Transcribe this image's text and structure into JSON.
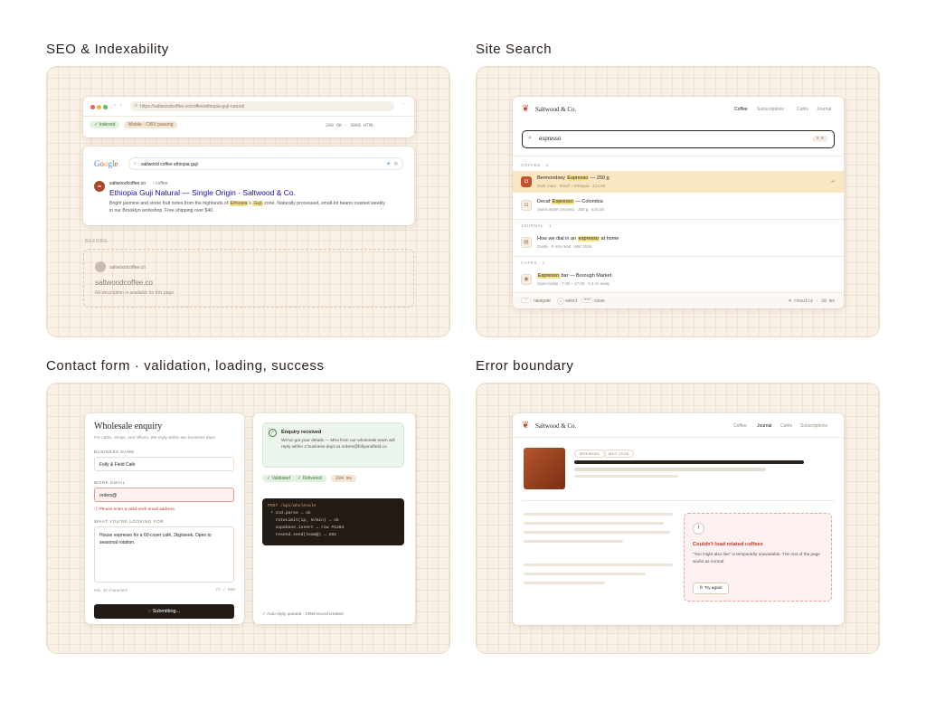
{
  "sections": {
    "seo": "SEO & Indexability",
    "search": "Site Search",
    "contact": "Contact form · validation, loading, success",
    "error": "Error boundary"
  },
  "seo": {
    "url": "https://saltwoodcoffee.co/coffee/ethiopia-guji-natural",
    "badge_indexed": "Indexed",
    "badge_mobile": "Mobile · CWV passing",
    "status": "200 OK · 38KB HTML",
    "google_logo": "Google",
    "query": "saltwood coffee ethiopia guji",
    "result_site": "saltwoodcoffee.co",
    "result_path": "› coffee",
    "result_title": "Ethiopia Guji Natural — Single Origin · Saltwood & Co.",
    "result_desc_1": "Bright jasmine and stone fruit notes from the highlands of",
    "result_desc_hl_1": "Ethiopia",
    "result_desc_2": "'s",
    "result_desc_hl_2": "Guji",
    "result_desc_3": "zone. Naturally processed, small-lot beans roasted weekly in our Brooklyn workshop. Free shipping over $40.",
    "before_label": "BEFORE",
    "before_site": "saltwoodcoffee.co",
    "before_title": "saltwoodcoffee.co",
    "before_desc": "No description is available for this page."
  },
  "search": {
    "brand": "Saltwood & Co.",
    "nav": [
      "Coffee",
      "Subscriptions",
      "Cafés",
      "Journal"
    ],
    "query": "espresso",
    "kbd": "⌘ K",
    "group_coffee": "COFFEE · 2",
    "group_journal": "JOURNAL · 1",
    "group_cafes": "CAFÉS · 1",
    "results": [
      {
        "pre": "Bermondsey ",
        "hl": "Espresso",
        "post": " — 250 g",
        "sub": "Dark roast · Brazil + Ethiopia · £14.50"
      },
      {
        "pre": "Decaf ",
        "hl": "Espresso",
        "post": " — Colombia",
        "sub": "Swiss water process · 250 g · £15.00"
      },
      {
        "pre": "How we dial in an ",
        "hl": "espresso",
        "post": " at home",
        "sub": "Guide · 6 min read · Mar 2026"
      },
      {
        "pre": "",
        "hl": "Espresso",
        "post": " bar — Borough Market",
        "sub": "Open today · 7:30 – 17:00 · 0.4 mi away"
      }
    ],
    "footer_navigate": "navigate",
    "footer_select": "select",
    "footer_close": "close",
    "footer_stats": "4 results · 38 ms"
  },
  "contact": {
    "title": "Wholesale enquiry",
    "subtitle": "For cafés, shops, and offices. We reply within two business days.",
    "label_business": "BUSINESS NAME",
    "value_business": "Folly & Field Café",
    "label_email": "WORK EMAIL",
    "value_email": "orders@",
    "error_email": "Please enter a valid work email address.",
    "label_looking": "WHAT YOU'RE LOOKING FOR",
    "value_looking": "House espresso for a 60-cover café, 2kg/week. Open to seasonal rotation.",
    "min_chars": "Min. 20 characters",
    "char_count": "72 / 500",
    "submit": "Submitting...",
    "success_title": "Enquiry received",
    "success_body": "We've got your details — Mira from our wholesale team will reply within 2 business days at orders@follyandfield.co.",
    "chip_validated": "Validated",
    "chip_delivered": "Delivered",
    "chip_time": "284 ms",
    "code": [
      "POST /api/wholesale",
      " └ zod.parse → ok",
      "   rateLimit(ip, 5/min) → ok",
      "   supabase.insert → row #1284",
      "   resend.send(team@) → 202"
    ],
    "footnote": "Auto-reply queued · CRM record created"
  },
  "error": {
    "brand": "Saltwood & Co.",
    "nav": [
      "Coffee",
      "Journal",
      "Cafés",
      "Subscriptions"
    ],
    "tag_1": "BREWING",
    "tag_2": "MAY 2026",
    "err_title": "Couldn't load related coffees",
    "err_body": "\"You might also like\" is temporarily unavailable. The rest of the page works as normal.",
    "retry": "Try again"
  },
  "colors": {
    "accent": "#c2552f",
    "highlight_row": "#fbe6c2",
    "error": "#c0392b",
    "success_bg": "#ecf5ec",
    "code_bg": "#231b16",
    "google_blue": "#1a0dab"
  }
}
